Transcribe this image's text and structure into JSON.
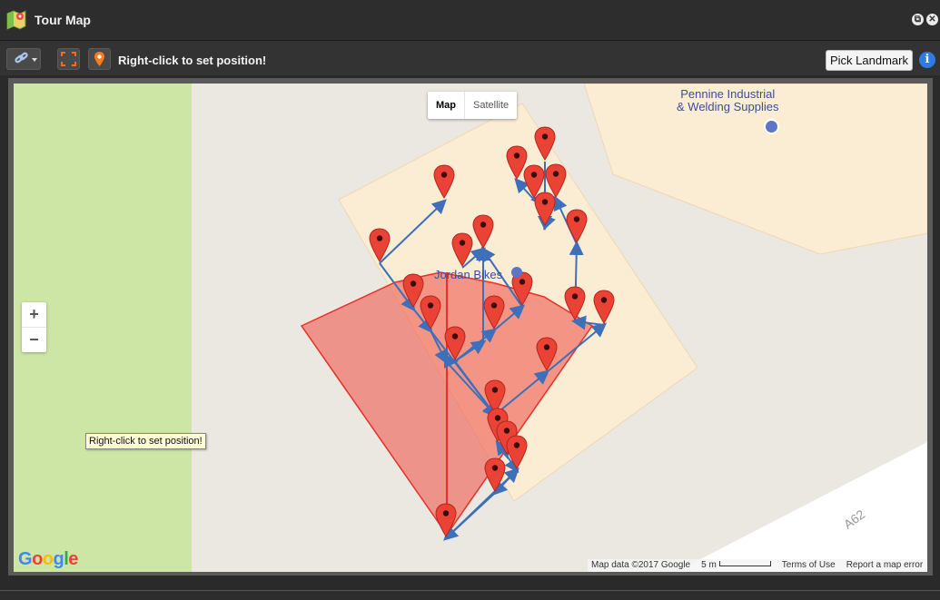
{
  "window": {
    "title": "Tour Map",
    "restore_icon": "restore-icon",
    "close_icon": "close-icon"
  },
  "toolbar": {
    "link_icon": "link-icon",
    "fit_icon": "fit-markers-icon",
    "pin_icon": "pin-icon",
    "status": "Right-click to set position!",
    "pick_label": "Pick Landmark",
    "info_icon": "info-icon"
  },
  "map": {
    "type_buttons": [
      "Map",
      "Satellite"
    ],
    "active_type": "Map",
    "zoom_in": "+",
    "zoom_out": "−",
    "poi_label_line1": "Pennine Industrial",
    "poi_label_line2": "& Welding Supplies",
    "shop_label": "Jordan Bikes",
    "road_label": "A62",
    "tooltip": "Right-click to set position!",
    "logo_letters": [
      "G",
      "o",
      "o",
      "g",
      "l",
      "e"
    ],
    "logo_colors": [
      "#4285F4",
      "#EA4335",
      "#FBBC05",
      "#4285F4",
      "#34A853",
      "#EA4335"
    ],
    "attribution": "Map data ©2017 Google",
    "scale": "5 m",
    "terms": "Terms of Use",
    "report": "Report a map error",
    "marker_color": "#ea4335",
    "path_color": "#3d6fba",
    "marker_count": 27
  }
}
